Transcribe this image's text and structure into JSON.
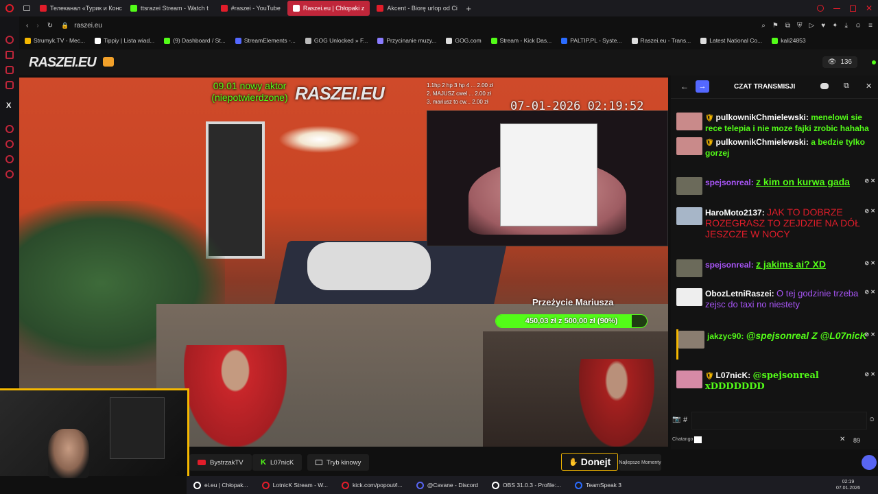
{
  "browser": {
    "tabs": [
      {
        "label": "Телеканал «Турик и Конс",
        "color": "#e11d2a"
      },
      {
        "label": "ttsrazei Stream - Watch t",
        "color": "#53fc18"
      },
      {
        "label": "#raszei - YouTube",
        "color": "#e11d2a"
      },
      {
        "label": "Raszei.eu | Chłopaki z",
        "color": "#ffffff",
        "active": true
      },
      {
        "label": "Akcent - Biorę urlop od Ci",
        "color": "#e11d2a"
      }
    ],
    "new_tab": "+",
    "url": "raszei.eu",
    "bookmarks": [
      "Strumyk.TV - Mec...",
      "Tippiy | Lista wiad...",
      "(9) Dashboard / St...",
      "StreamElements -...",
      "GOG Unlocked » F...",
      "Przycinanie muzy...",
      "GOG.com",
      "Stream - Kick Das...",
      "PALTIP.PL - Syste...",
      "Raszei.eu - Trans...",
      "Latest National Co...",
      "kali24853"
    ]
  },
  "site": {
    "logo": "RASZEI.EU",
    "viewers": "136"
  },
  "overlay": {
    "new_actor_line1": "09.01 nowy aktor",
    "new_actor_line2": "(niepotwierdzone)",
    "watermark": "RASZEI.EU",
    "top_donors": [
      "1.1hp 2 hp 3 hp 4 ... 2.00 zł",
      "2. MAJUSZ cwel ... 2.00 zł",
      "3. mariusz to cw... 2.00 zł"
    ],
    "timestamp": "07-01-2026 02:19:52",
    "goal_title": "Przeżycie Mariusza",
    "goal_amount": "450,03 zł z 500,00 zł",
    "goal_percent_text": "(90%)",
    "goal_fraction": 0.9
  },
  "chat": {
    "title": "CZAT TRANSMISJI",
    "messages": [
      {
        "user": "pulkownikChmielewski:",
        "text": "menelowi sie rece telepia i nie moze fajki zrobic hahaha",
        "text_color": "green",
        "badge": true
      },
      {
        "user": "pulkownikChmielewski:",
        "text": "a bedzie tylko gorzej",
        "text_color": "green",
        "badge": true
      },
      {
        "user": "spejsonreal:",
        "text": "z kim on kurwa gada",
        "text_color": "green",
        "user_color": "purple",
        "underline": true
      },
      {
        "user": "HaroMoto2137:",
        "text": "JAK TO DOBRZE ROZEGRASZ TO ZEJDZIE NA DÓŁ JESZCZE W NOCY",
        "text_color": "red"
      },
      {
        "user": "spejsonreal:",
        "text": "z jakims ai? XD",
        "text_color": "green",
        "user_color": "purple",
        "underline": true
      },
      {
        "user": "ObozLetniRaszei:",
        "text": "O tej godzinie trzeba zejsc do taxi no niestety",
        "text_color": "purple"
      },
      {
        "user": "jakzyc90:",
        "text": "@spejsonreal Z @L07nicK",
        "text_color": "green",
        "user_color": "green",
        "italic": true
      },
      {
        "user": "L07nicK:",
        "text": "@spejsonreal xDDDDDDD",
        "text_color": "green",
        "badge": true,
        "serif": true
      }
    ],
    "input_placeholder": "",
    "hash": "#",
    "chatango_label": "Chatango",
    "volume": "89"
  },
  "bottom_bar": {
    "buttons": [
      "BystrzakTV",
      "L07nicK",
      "Tryb kinowy"
    ],
    "donate": "Donejt",
    "top_label": "Najlepsze Momenty"
  },
  "taskbar": {
    "items": [
      "ei.eu | Chłopak...",
      "LotnicK Stream - W...",
      "kick.com/popout/l...",
      "@Cavane - Discord",
      "OBS 31.0.3 - Profile:...",
      "TeamSpeak 3"
    ],
    "time": "02:19",
    "date": "07.01.2026"
  }
}
